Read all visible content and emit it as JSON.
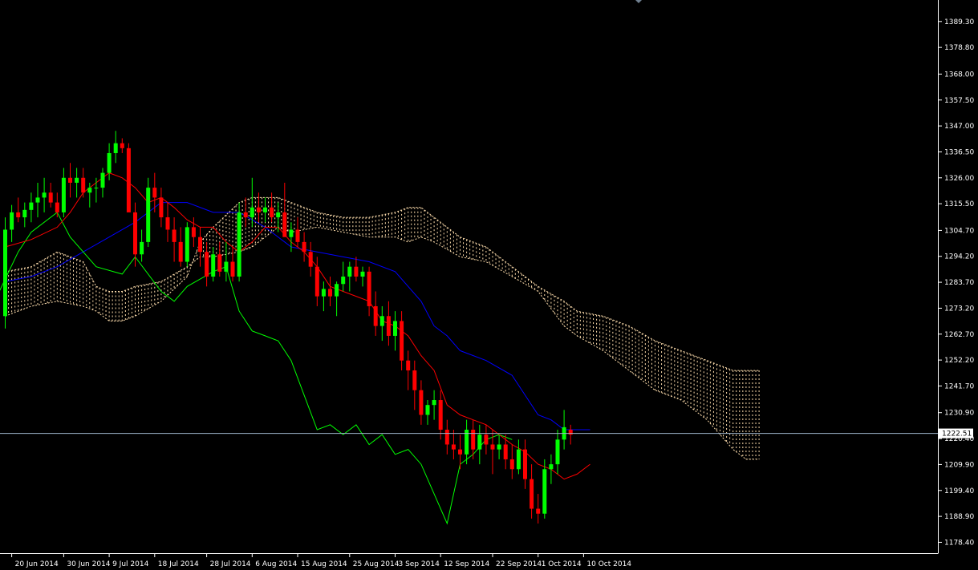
{
  "chart_data": {
    "type": "candlestick",
    "grid": false,
    "ylim": [
      1174.0,
      1398.0
    ],
    "x_tick_labels": [
      {
        "idx": 1,
        "label": "20 Jun 2014"
      },
      {
        "idx": 9,
        "label": "30 Jun 2014"
      },
      {
        "idx": 16,
        "label": "9 Jul 2014"
      },
      {
        "idx": 23,
        "label": "18 Jul 2014"
      },
      {
        "idx": 31,
        "label": "28 Jul 2014"
      },
      {
        "idx": 38,
        "label": "6 Aug 2014"
      },
      {
        "idx": 45,
        "label": "15 Aug 2014"
      },
      {
        "idx": 53,
        "label": "25 Aug 2014"
      },
      {
        "idx": 60,
        "label": "3 Sep 2014"
      },
      {
        "idx": 67,
        "label": "12 Sep 2014"
      },
      {
        "idx": 75,
        "label": "22 Sep 2014"
      },
      {
        "idx": 82,
        "label": "1 Oct 2014"
      },
      {
        "idx": 89,
        "label": "10 Oct 2014"
      }
    ],
    "y_ticks": [
      1389.3,
      1378.8,
      1368.0,
      1357.5,
      1347.0,
      1336.5,
      1326.0,
      1315.5,
      1304.7,
      1294.2,
      1283.7,
      1273.2,
      1262.7,
      1252.2,
      1241.7,
      1230.9,
      1220.4,
      1209.9,
      1199.4,
      1188.9,
      1178.4
    ],
    "current_price": 1222.51,
    "colors": {
      "background": "#000000",
      "bull": "#00ff00",
      "bear": "#ff0000",
      "tenkan": "#ff0000",
      "kijun": "#0000ff",
      "chikou": "#00ff00",
      "cloud": "#ffdead",
      "price_line": "#9fb6cd",
      "axis": "#ffffff"
    },
    "candles": [
      [
        1270,
        1310,
        1265,
        1305
      ],
      [
        1305,
        1315,
        1300,
        1312
      ],
      [
        1312,
        1318,
        1308,
        1310
      ],
      [
        1310,
        1316,
        1306,
        1313
      ],
      [
        1313,
        1320,
        1308,
        1316
      ],
      [
        1316,
        1324,
        1310,
        1318
      ],
      [
        1318,
        1326,
        1312,
        1320
      ],
      [
        1320,
        1324,
        1314,
        1316
      ],
      [
        1316,
        1320,
        1310,
        1312
      ],
      [
        1312,
        1330,
        1310,
        1326
      ],
      [
        1326,
        1332,
        1318,
        1324
      ],
      [
        1324,
        1330,
        1318,
        1326
      ],
      [
        1326,
        1330,
        1318,
        1320
      ],
      [
        1320,
        1324,
        1314,
        1322
      ],
      [
        1322,
        1326,
        1316,
        1322
      ],
      [
        1322,
        1330,
        1318,
        1328
      ],
      [
        1328,
        1340,
        1325,
        1336
      ],
      [
        1336,
        1345,
        1332,
        1340
      ],
      [
        1340,
        1342,
        1336,
        1338
      ],
      [
        1338,
        1340,
        1320,
        1312
      ],
      [
        1312,
        1316,
        1290,
        1295
      ],
      [
        1295,
        1305,
        1292,
        1300
      ],
      [
        1300,
        1326,
        1298,
        1322
      ],
      [
        1322,
        1328,
        1312,
        1318
      ],
      [
        1318,
        1322,
        1306,
        1310
      ],
      [
        1310,
        1316,
        1300,
        1305
      ],
      [
        1305,
        1310,
        1292,
        1300
      ],
      [
        1300,
        1306,
        1290,
        1292
      ],
      [
        1292,
        1308,
        1290,
        1306
      ],
      [
        1306,
        1310,
        1298,
        1302
      ],
      [
        1302,
        1306,
        1290,
        1296
      ],
      [
        1296,
        1300,
        1282,
        1286
      ],
      [
        1286,
        1298,
        1284,
        1295
      ],
      [
        1295,
        1300,
        1286,
        1288
      ],
      [
        1288,
        1300,
        1284,
        1292
      ],
      [
        1292,
        1298,
        1284,
        1286
      ],
      [
        1286,
        1316,
        1284,
        1312
      ],
      [
        1312,
        1318,
        1306,
        1310
      ],
      [
        1310,
        1326,
        1306,
        1314
      ],
      [
        1314,
        1320,
        1308,
        1312
      ],
      [
        1312,
        1318,
        1308,
        1314
      ],
      [
        1314,
        1320,
        1308,
        1310
      ],
      [
        1310,
        1316,
        1304,
        1312
      ],
      [
        1312,
        1324,
        1306,
        1302
      ],
      [
        1302,
        1308,
        1296,
        1305
      ],
      [
        1305,
        1310,
        1298,
        1300
      ],
      [
        1300,
        1304,
        1292,
        1296
      ],
      [
        1296,
        1300,
        1286,
        1290
      ],
      [
        1290,
        1294,
        1274,
        1278
      ],
      [
        1278,
        1284,
        1272,
        1281
      ],
      [
        1281,
        1286,
        1274,
        1278
      ],
      [
        1278,
        1284,
        1270,
        1283
      ],
      [
        1283,
        1292,
        1280,
        1286
      ],
      [
        1286,
        1292,
        1280,
        1290
      ],
      [
        1290,
        1294,
        1284,
        1286
      ],
      [
        1286,
        1290,
        1282,
        1288
      ],
      [
        1288,
        1290,
        1270,
        1274
      ],
      [
        1274,
        1280,
        1262,
        1266
      ],
      [
        1266,
        1274,
        1260,
        1270
      ],
      [
        1270,
        1276,
        1258,
        1262
      ],
      [
        1262,
        1272,
        1256,
        1268
      ],
      [
        1268,
        1272,
        1248,
        1252
      ],
      [
        1252,
        1256,
        1240,
        1248
      ],
      [
        1248,
        1252,
        1232,
        1240
      ],
      [
        1240,
        1244,
        1226,
        1230
      ],
      [
        1230,
        1236,
        1226,
        1234
      ],
      [
        1234,
        1240,
        1228,
        1236
      ],
      [
        1236,
        1240,
        1220,
        1224
      ],
      [
        1224,
        1228,
        1214,
        1218
      ],
      [
        1218,
        1224,
        1212,
        1216
      ],
      [
        1216,
        1222,
        1208,
        1214
      ],
      [
        1214,
        1228,
        1210,
        1224
      ],
      [
        1224,
        1228,
        1212,
        1216
      ],
      [
        1216,
        1226,
        1210,
        1222
      ],
      [
        1222,
        1226,
        1214,
        1218
      ],
      [
        1218,
        1224,
        1206,
        1216
      ],
      [
        1216,
        1222,
        1212,
        1218
      ],
      [
        1218,
        1222,
        1208,
        1212
      ],
      [
        1212,
        1218,
        1204,
        1208
      ],
      [
        1208,
        1220,
        1206,
        1216
      ],
      [
        1216,
        1220,
        1200,
        1204
      ],
      [
        1204,
        1210,
        1188,
        1192
      ],
      [
        1192,
        1198,
        1186,
        1190
      ],
      [
        1190,
        1212,
        1188,
        1208
      ],
      [
        1208,
        1214,
        1202,
        1210
      ],
      [
        1210,
        1224,
        1206,
        1220
      ],
      [
        1220,
        1232,
        1216,
        1225
      ],
      [
        1224,
        1226,
        1218,
        1222
      ]
    ],
    "tenkan": [
      [
        0,
        1298
      ],
      [
        4,
        1301
      ],
      [
        8,
        1306
      ],
      [
        10,
        1312
      ],
      [
        12,
        1320
      ],
      [
        14,
        1324
      ],
      [
        16,
        1328
      ],
      [
        18,
        1326
      ],
      [
        20,
        1322
      ],
      [
        22,
        1316
      ],
      [
        24,
        1318
      ],
      [
        26,
        1314
      ],
      [
        28,
        1309
      ],
      [
        30,
        1306
      ],
      [
        32,
        1306
      ],
      [
        34,
        1300
      ],
      [
        36,
        1296
      ],
      [
        38,
        1300
      ],
      [
        40,
        1306
      ],
      [
        42,
        1306
      ],
      [
        44,
        1300
      ],
      [
        46,
        1296
      ],
      [
        48,
        1290
      ],
      [
        50,
        1282
      ],
      [
        52,
        1280
      ],
      [
        54,
        1278
      ],
      [
        56,
        1276
      ],
      [
        58,
        1268
      ],
      [
        60,
        1266
      ],
      [
        62,
        1262
      ],
      [
        64,
        1254
      ],
      [
        66,
        1248
      ],
      [
        68,
        1234
      ],
      [
        70,
        1230
      ],
      [
        72,
        1228
      ],
      [
        74,
        1226
      ],
      [
        76,
        1222
      ],
      [
        78,
        1218
      ],
      [
        80,
        1215
      ],
      [
        82,
        1210
      ],
      [
        84,
        1208
      ],
      [
        86,
        1204
      ],
      [
        88,
        1206
      ],
      [
        90,
        1210
      ]
    ],
    "kijun": [
      [
        0,
        1284
      ],
      [
        4,
        1286
      ],
      [
        8,
        1290
      ],
      [
        12,
        1296
      ],
      [
        16,
        1302
      ],
      [
        20,
        1308
      ],
      [
        24,
        1316
      ],
      [
        28,
        1316
      ],
      [
        32,
        1312
      ],
      [
        36,
        1312
      ],
      [
        40,
        1306
      ],
      [
        44,
        1298
      ],
      [
        48,
        1296
      ],
      [
        52,
        1294
      ],
      [
        56,
        1292
      ],
      [
        60,
        1288
      ],
      [
        64,
        1276
      ],
      [
        66,
        1266
      ],
      [
        68,
        1262
      ],
      [
        70,
        1256
      ],
      [
        74,
        1252
      ],
      [
        78,
        1246
      ],
      [
        80,
        1238
      ],
      [
        82,
        1230
      ],
      [
        84,
        1228
      ],
      [
        86,
        1224
      ],
      [
        90,
        1224
      ]
    ],
    "chikou": [
      [
        -2,
        1274
      ],
      [
        2,
        1296
      ],
      [
        4,
        1304
      ],
      [
        8,
        1312
      ],
      [
        10,
        1302
      ],
      [
        14,
        1290
      ],
      [
        18,
        1287
      ],
      [
        20,
        1294
      ],
      [
        24,
        1280
      ],
      [
        26,
        1276
      ],
      [
        28,
        1282
      ],
      [
        30,
        1285
      ],
      [
        32,
        1288
      ],
      [
        34,
        1290
      ],
      [
        36,
        1272
      ],
      [
        38,
        1264
      ],
      [
        40,
        1262
      ],
      [
        42,
        1260
      ],
      [
        44,
        1252
      ],
      [
        46,
        1238
      ],
      [
        48,
        1224
      ],
      [
        50,
        1226
      ],
      [
        52,
        1222
      ],
      [
        54,
        1226
      ],
      [
        56,
        1218
      ],
      [
        58,
        1222
      ],
      [
        60,
        1214
      ],
      [
        62,
        1216
      ],
      [
        64,
        1210
      ],
      [
        66,
        1198
      ],
      [
        68,
        1186
      ],
      [
        70,
        1210
      ],
      [
        72,
        1214
      ],
      [
        74,
        1220
      ],
      [
        76,
        1222
      ],
      [
        78,
        1220
      ]
    ],
    "span_a": [
      [
        0,
        1288
      ],
      [
        4,
        1290
      ],
      [
        8,
        1296
      ],
      [
        12,
        1292
      ],
      [
        14,
        1282
      ],
      [
        16,
        1280
      ],
      [
        18,
        1280
      ],
      [
        20,
        1282
      ],
      [
        24,
        1284
      ],
      [
        28,
        1290
      ],
      [
        30,
        1294
      ],
      [
        32,
        1294
      ],
      [
        36,
        1296
      ],
      [
        38,
        1298
      ],
      [
        42,
        1306
      ],
      [
        44,
        1304
      ],
      [
        48,
        1306
      ],
      [
        52,
        1304
      ],
      [
        56,
        1302
      ],
      [
        60,
        1302
      ],
      [
        62,
        1300
      ],
      [
        64,
        1302
      ],
      [
        66,
        1300
      ],
      [
        70,
        1294
      ],
      [
        74,
        1292
      ],
      [
        78,
        1286
      ],
      [
        82,
        1280
      ],
      [
        86,
        1266
      ],
      [
        88,
        1262
      ],
      [
        92,
        1256
      ],
      [
        96,
        1248
      ],
      [
        100,
        1240
      ],
      [
        104,
        1236
      ],
      [
        108,
        1228
      ],
      [
        110,
        1222
      ],
      [
        112,
        1216
      ],
      [
        114,
        1212
      ],
      [
        116,
        1212
      ]
    ],
    "span_b": [
      [
        0,
        1270
      ],
      [
        4,
        1274
      ],
      [
        8,
        1276
      ],
      [
        12,
        1274
      ],
      [
        14,
        1272
      ],
      [
        16,
        1268
      ],
      [
        18,
        1268
      ],
      [
        20,
        1270
      ],
      [
        24,
        1276
      ],
      [
        28,
        1286
      ],
      [
        30,
        1300
      ],
      [
        32,
        1306
      ],
      [
        36,
        1316
      ],
      [
        38,
        1318
      ],
      [
        42,
        1318
      ],
      [
        44,
        1316
      ],
      [
        48,
        1312
      ],
      [
        52,
        1310
      ],
      [
        56,
        1310
      ],
      [
        60,
        1312
      ],
      [
        62,
        1314
      ],
      [
        64,
        1314
      ],
      [
        66,
        1310
      ],
      [
        70,
        1302
      ],
      [
        74,
        1298
      ],
      [
        78,
        1290
      ],
      [
        82,
        1282
      ],
      [
        86,
        1276
      ],
      [
        88,
        1272
      ],
      [
        92,
        1270
      ],
      [
        96,
        1266
      ],
      [
        100,
        1260
      ],
      [
        104,
        1256
      ],
      [
        108,
        1252
      ],
      [
        110,
        1250
      ],
      [
        112,
        1248
      ],
      [
        114,
        1248
      ],
      [
        116,
        1248
      ]
    ]
  }
}
